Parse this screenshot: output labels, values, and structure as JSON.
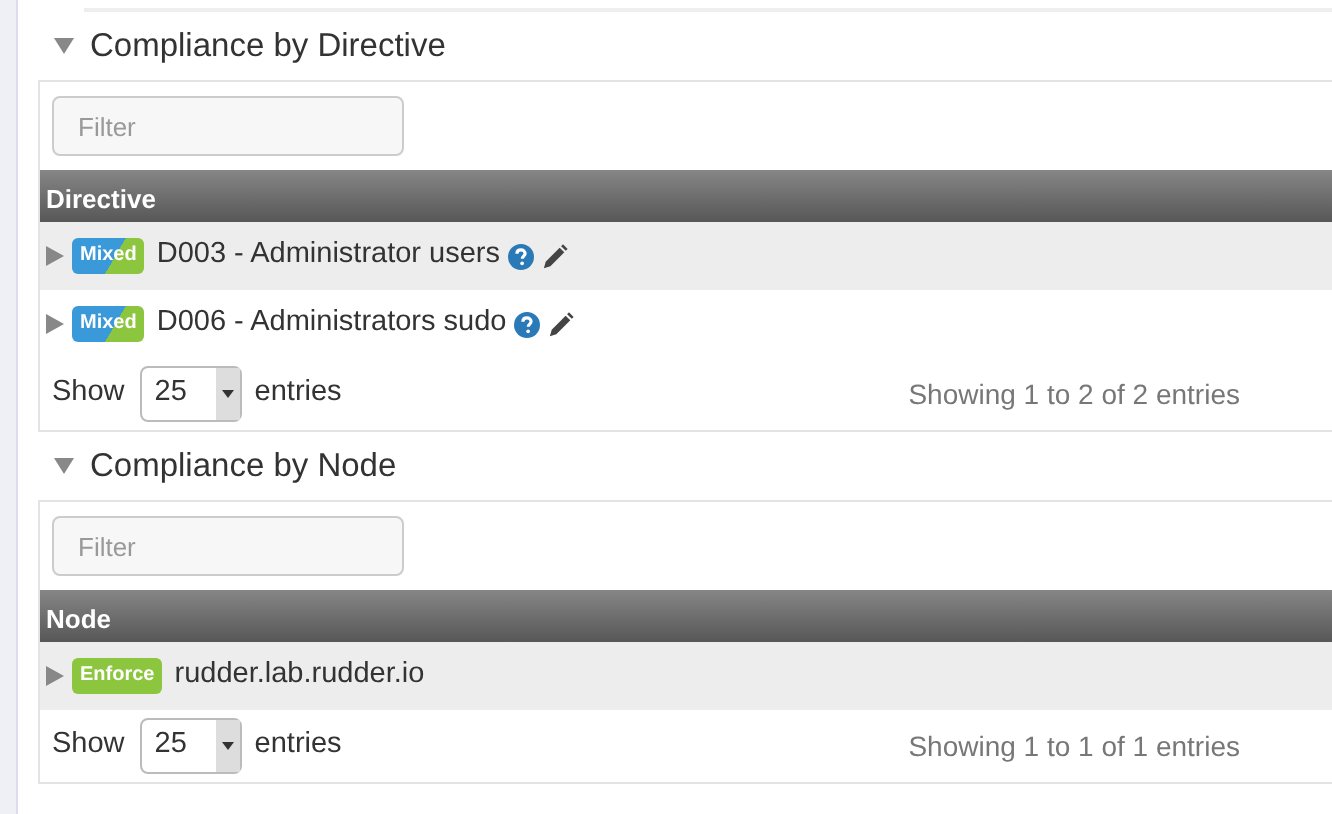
{
  "sections": [
    {
      "title": "Compliance by Directive",
      "expanded": true,
      "filter": {
        "placeholder": "Filter"
      },
      "column": "Directive",
      "rows": [
        {
          "badge": "Mixed",
          "kind": "mixed",
          "label": "D003 - Administrator users",
          "help": true,
          "edit": true
        },
        {
          "badge": "Mixed",
          "kind": "mixed",
          "label": "D006 - Administrators sudo",
          "help": true,
          "edit": true
        }
      ],
      "show_label": "Show",
      "page_size": "25",
      "entries_label": "entries",
      "info": "Showing 1 to 2 of 2 entries"
    },
    {
      "title": "Compliance by Node",
      "expanded": true,
      "filter": {
        "placeholder": "Filter"
      },
      "column": "Node",
      "rows": [
        {
          "badge": "Enforce",
          "kind": "enforce",
          "label": "rudder.lab.rudder.io",
          "help": false,
          "edit": false
        }
      ],
      "show_label": "Show",
      "page_size": "25",
      "entries_label": "entries",
      "info": "Showing 1 to 1 of 1 entries"
    }
  ]
}
